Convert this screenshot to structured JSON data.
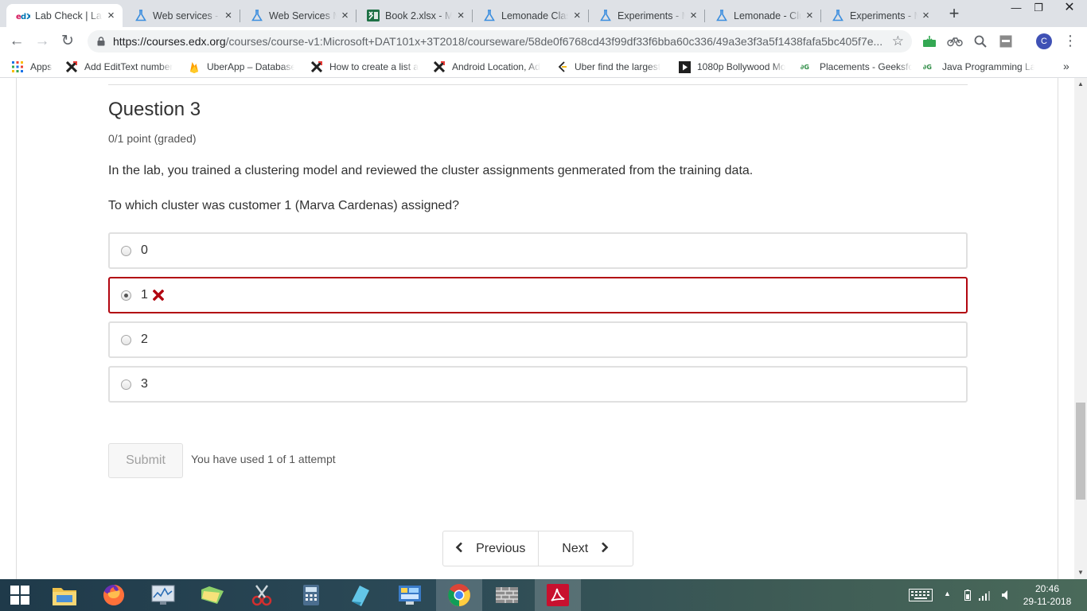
{
  "browser": {
    "tabs": [
      {
        "title": "Lab Check | Lab",
        "icon": "edx-icon",
        "active": true
      },
      {
        "title": "Web services -",
        "icon": "flask-icon"
      },
      {
        "title": "Web Services M",
        "icon": "flask-icon"
      },
      {
        "title": "Book 2.xlsx - M",
        "icon": "excel-icon"
      },
      {
        "title": "Lemonade Clas",
        "icon": "flask-icon"
      },
      {
        "title": "Experiments - M",
        "icon": "flask-icon"
      },
      {
        "title": "Lemonade - Clu",
        "icon": "flask-icon"
      },
      {
        "title": "Experiments - M",
        "icon": "flask-icon"
      }
    ],
    "url_host": "https://courses.edx.org",
    "url_path": "/courses/course-v1:Microsoft+DAT101x+3T2018/courseware/58de0f6768cd43f99df33f6bba60c336/49a3e3f3a5f1438fafa5bc405f7e...",
    "profile_initial": "C",
    "bookmarks": [
      {
        "label": "Apps",
        "icon": "apps-grid-icon"
      },
      {
        "label": "Add EditText number",
        "icon": "x-logo-icon"
      },
      {
        "label": "UberApp – Database",
        "icon": "firebase-icon"
      },
      {
        "label": "How to create a list a",
        "icon": "x-logo-icon"
      },
      {
        "label": "Android Location, Ad",
        "icon": "x-logo-icon"
      },
      {
        "label": "Uber find the largest",
        "icon": "code-icon"
      },
      {
        "label": "1080p Bollywood Mo",
        "icon": "play-icon"
      },
      {
        "label": "Placements - Geeksfo",
        "icon": "gfg-icon"
      },
      {
        "label": "Java Programming La",
        "icon": "gfg-icon"
      }
    ],
    "bookmarks_more": "»"
  },
  "question": {
    "title": "Question 3",
    "points": "0/1 point (graded)",
    "text": "In the lab, you trained a clustering model and reviewed the cluster assignments genmerated from the training data.",
    "prompt": "To which cluster was customer 1 (Marva Cardenas) assigned?",
    "options": [
      {
        "label": "0",
        "selected": false,
        "incorrect": false
      },
      {
        "label": "1",
        "selected": true,
        "incorrect": true
      },
      {
        "label": "2",
        "selected": false,
        "incorrect": false
      },
      {
        "label": "3",
        "selected": false,
        "incorrect": false
      }
    ],
    "submit_label": "Submit",
    "attempts_text": "You have used 1 of 1 attempt"
  },
  "pager": {
    "previous_label": "Previous",
    "next_label": "Next"
  },
  "colors": {
    "incorrect_border": "#b20610",
    "incorrect_icon": "#b20610"
  },
  "taskbar": {
    "apps": [
      "windows-start-icon",
      "file-explorer-icon",
      "firefox-icon",
      "performance-monitor-icon",
      "folder-icon",
      "snipping-tool-icon",
      "calculator-icon",
      "sticky-notes-icon",
      "control-panel-icon",
      "chrome-icon",
      "wall-icon",
      "acrobat-icon"
    ],
    "time": "20:46",
    "date": "29-11-2018"
  }
}
